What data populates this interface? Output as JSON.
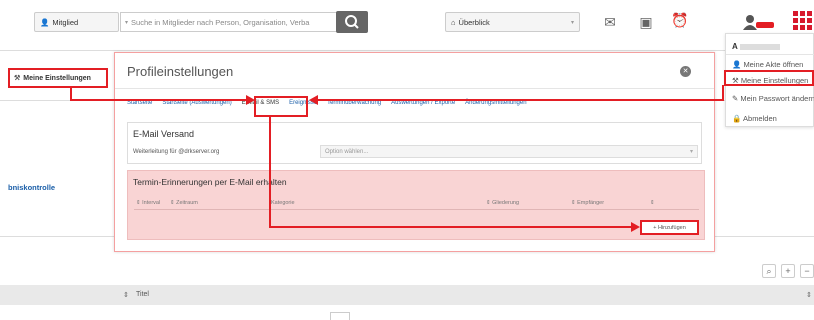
{
  "topbar": {
    "member_select": "Mitglied",
    "search_placeholder": "Suche in Mitglieder nach Person, Organisation, Verba",
    "overview_select": "Überblick"
  },
  "page": {
    "my_settings_button": "Meine Einstellungen",
    "left_section_label": "bniskontrolle",
    "table_title_header": "Titel"
  },
  "modal": {
    "title": "Profileinstellungen",
    "tabs": [
      "Startseite",
      "Startseite (Auswertungen)",
      "E-Mail & SMS",
      "Ereignisse",
      "Terminüberwachung",
      "Auswertungen / Exporte",
      "Änderungsmitteilungen"
    ],
    "email_section": {
      "title": "E-Mail Versand",
      "forward_label": "Weiterleitung für @drkserver.org",
      "forward_placeholder": "Option wählen..."
    },
    "reminder_section": {
      "title": "Termin-Erinnerungen per E-Mail erhalten",
      "columns": [
        "Interval",
        "Zeitraum",
        "Kategorie",
        "Gliederung",
        "Empfänger"
      ],
      "add_button": "+ Hinzufügen"
    }
  },
  "dropdown": {
    "user_initial": "A",
    "items": [
      "Meine Akte öffnen",
      "Meine Einstellungen",
      "Mein Passwort ändern",
      "Abmelden"
    ]
  },
  "colors": {
    "highlight": "#e31e24",
    "link": "#1a5ea8",
    "reminder_bg": "#f9d4d4"
  }
}
